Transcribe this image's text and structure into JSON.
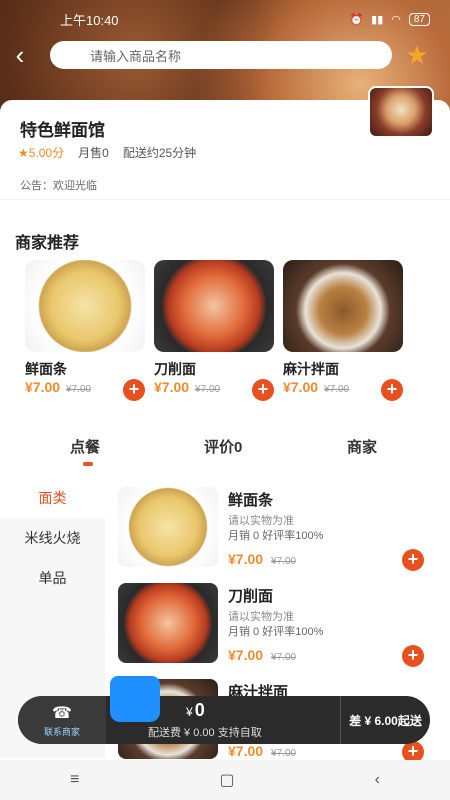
{
  "status": {
    "time": "上午10:40",
    "battery": "87"
  },
  "search": {
    "placeholder": "请输入商品名称"
  },
  "shop": {
    "name": "特色鲜面馆",
    "rating": "5.00分",
    "monthly_sales": "月售0",
    "delivery_time": "配送约25分钟",
    "notice": "公告：欢迎光临"
  },
  "recommend": {
    "title": "商家推荐",
    "items": [
      {
        "name": "鲜面条",
        "price": "¥7.00",
        "old_price": "¥7.00"
      },
      {
        "name": "刀削面",
        "price": "¥7.00",
        "old_price": "¥7.00"
      },
      {
        "name": "麻汁拌面",
        "price": "¥7.00",
        "old_price": "¥7.00"
      }
    ]
  },
  "tabs": [
    {
      "label": "点餐"
    },
    {
      "label": "评价0"
    },
    {
      "label": "商家"
    }
  ],
  "categories": [
    {
      "label": "面类"
    },
    {
      "label": "米线火烧"
    },
    {
      "label": "单品"
    }
  ],
  "products": [
    {
      "name": "鲜面条",
      "note": "请以实物为准",
      "stats": "月销 0   好评率100%",
      "price": "¥7.00",
      "old_price": "¥7.00"
    },
    {
      "name": "刀削面",
      "note": "请以实物为准",
      "stats": "月销 0   好评率100%",
      "price": "¥7.00",
      "old_price": "¥7.00"
    },
    {
      "name": "麻汁拌面",
      "note": "",
      "stats": "",
      "price": "¥7.00",
      "old_price": "¥7.00"
    }
  ],
  "cart": {
    "contact_label": "联系商家",
    "currency": "¥",
    "total": "0",
    "subtitle": "配送费 ¥ 0.00 支持自取",
    "min_order": "差 ¥ 6.00起送"
  }
}
